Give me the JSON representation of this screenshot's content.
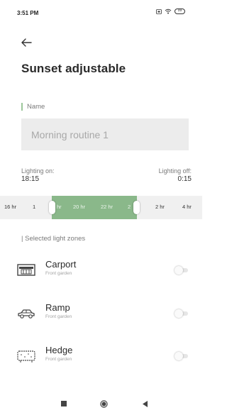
{
  "status_bar": {
    "time": "3:51 PM",
    "battery": "99"
  },
  "page": {
    "title": "Sunset adjustable"
  },
  "name": {
    "label": "Name",
    "value": "Morning routine 1"
  },
  "lighting": {
    "on_label": "Lighting on:",
    "on_value": "18:15",
    "off_label": "Lighting off:",
    "off_value": "0:15"
  },
  "timeline": {
    "labels": [
      "16 hr",
      "18 hr",
      "20 hr",
      "22 hr",
      "24",
      "2 hr",
      "4 hr"
    ],
    "visible_labels": [
      "16 hr",
      "1 ",
      "hr",
      "20 hr",
      "22 hr",
      "2",
      "2 hr",
      "4 hr"
    ]
  },
  "zones_section": {
    "label": "| Selected light zones"
  },
  "zones": [
    {
      "name": "Carport",
      "location": "Front garden",
      "icon": "carport-icon",
      "enabled": false
    },
    {
      "name": "Ramp",
      "location": "Front garden",
      "icon": "car-icon",
      "enabled": false
    },
    {
      "name": "Hedge",
      "location": "Front garden",
      "icon": "hedge-icon",
      "enabled": false
    }
  ],
  "colors": {
    "accent_green": "#8ab88a",
    "label_border": "#9bc79a",
    "input_bg": "#ececec"
  }
}
